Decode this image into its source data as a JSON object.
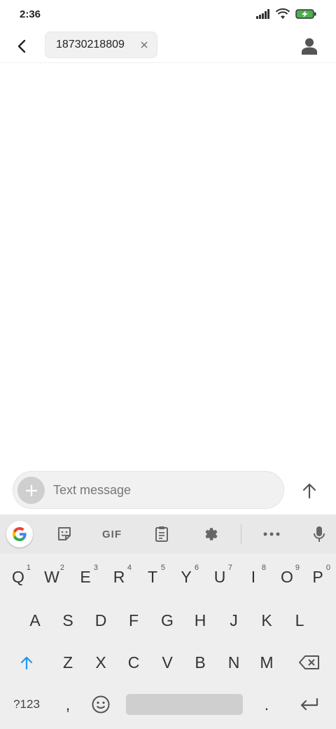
{
  "status": {
    "time": "2:36"
  },
  "header": {
    "recipient": "18730218809"
  },
  "compose": {
    "placeholder": "Text message"
  },
  "keyboard": {
    "toolbar": {
      "gif_label": "GIF"
    },
    "row1": [
      {
        "label": "Q",
        "hint": "1"
      },
      {
        "label": "W",
        "hint": "2"
      },
      {
        "label": "E",
        "hint": "3"
      },
      {
        "label": "R",
        "hint": "4"
      },
      {
        "label": "T",
        "hint": "5"
      },
      {
        "label": "Y",
        "hint": "6"
      },
      {
        "label": "U",
        "hint": "7"
      },
      {
        "label": "I",
        "hint": "8"
      },
      {
        "label": "O",
        "hint": "9"
      },
      {
        "label": "P",
        "hint": "0"
      }
    ],
    "row2": [
      "A",
      "S",
      "D",
      "F",
      "G",
      "H",
      "J",
      "K",
      "L"
    ],
    "row3": [
      "Z",
      "X",
      "C",
      "V",
      "B",
      "N",
      "M"
    ],
    "symbols_label": "?123",
    "comma_label": ",",
    "period_label": "."
  },
  "colors": {
    "accent": "#2196f3",
    "battery": "#4caf50"
  }
}
